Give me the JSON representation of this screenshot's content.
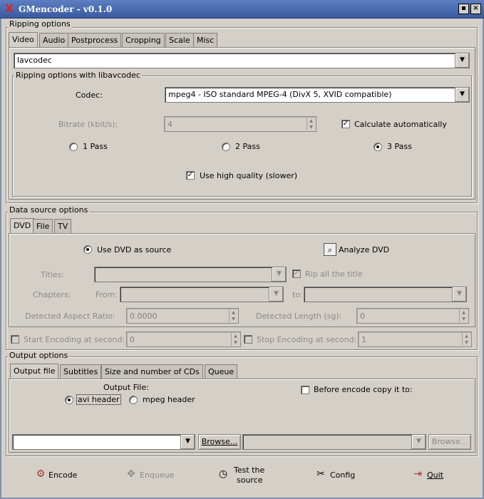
{
  "window": {
    "title": "GMencoder - v0.1.0",
    "btn_min": "▪",
    "btn_close": "×"
  },
  "ripping": {
    "label": "Ripping options",
    "tabs": [
      "Video",
      "Audio",
      "Postprocess",
      "Cropping",
      "Scale",
      "Misc"
    ],
    "method_value": "lavcodec",
    "lib_label": "Ripping options with libavcodec",
    "codec_label": "Codec:",
    "codec_value": "mpeg4 - ISO standard MPEG-4 (DivX 5, XVID compatible)",
    "bitrate_label": "Bitrate (kbit/s):",
    "bitrate_value": "4",
    "calc_auto_label": "Calculate automatically",
    "pass1_label": "1 Pass",
    "pass2_label": "2 Pass",
    "pass3_label": "3 Pass",
    "high_quality_label": "Use high quality (slower)"
  },
  "datasource": {
    "label": "Data source options",
    "tabs": [
      "DVD",
      "File",
      "TV"
    ],
    "use_dvd_label": "Use DVD as source",
    "analyze_label": "Analyze DVD",
    "titles_label": "Titles:",
    "rip_all_label": "Rip all the title",
    "chapters_label": "Chapters:",
    "from_label": "From:",
    "to_label": "to:",
    "aspect_label": "Detected Aspect Ratio:",
    "aspect_value": "0.0000",
    "length_label": "Detected Length (sg):",
    "length_value": "0",
    "start_label": "Start Encoding at second:",
    "start_value": "0",
    "stop_label": "Stop Encoding at second:",
    "stop_value": "1"
  },
  "output": {
    "label": "Output options",
    "tabs": [
      "Output file",
      "Subtitles",
      "Size and number of CDs",
      "Queue"
    ],
    "output_file_label": "Output File:",
    "avi_label": "avi header",
    "mpeg_label": "mpeg header",
    "copy_label": "Before encode copy it to:",
    "browse1": "Browse...",
    "browse2": "Browse..."
  },
  "bottom": {
    "encode": "Encode",
    "enqueue": "Enqueue",
    "test_line1": "Test the",
    "test_line2": "source",
    "config": "Config",
    "quit": "Quit"
  }
}
